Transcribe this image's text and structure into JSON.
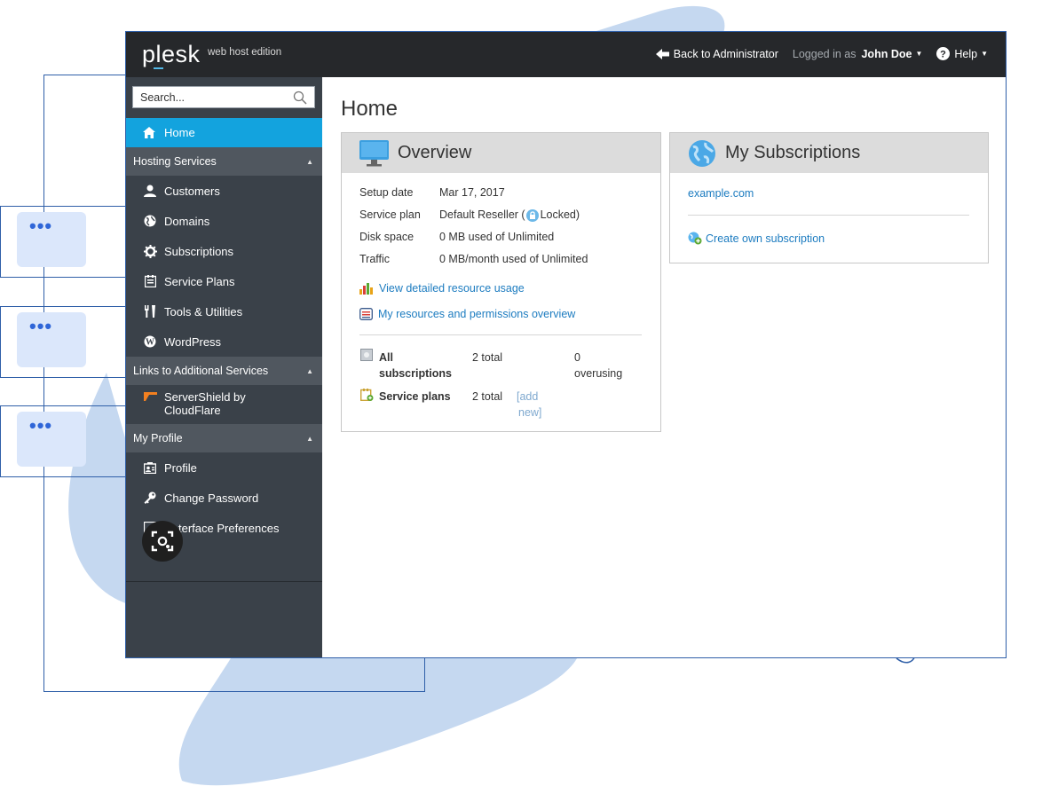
{
  "app": {
    "logo": "plesk",
    "edition": "web host edition"
  },
  "topbar": {
    "back_label": "Back to Administrator",
    "logged_in_prefix": "Logged in as",
    "user_name": "John Doe",
    "help_label": "Help"
  },
  "search": {
    "placeholder": "Search..."
  },
  "sidebar": {
    "home": "Home",
    "hosting_section": "Hosting Services",
    "hosting_items": [
      {
        "label": "Customers",
        "icon": "user-icon"
      },
      {
        "label": "Domains",
        "icon": "globe-icon"
      },
      {
        "label": "Subscriptions",
        "icon": "gear-icon"
      },
      {
        "label": "Service Plans",
        "icon": "plans-icon"
      },
      {
        "label": "Tools & Utilities",
        "icon": "tools-icon"
      },
      {
        "label": "WordPress",
        "icon": "wordpress-icon"
      }
    ],
    "links_section": "Links to Additional Services",
    "links_items": [
      {
        "label_line1": "ServerShield by",
        "label_line2": "CloudFlare",
        "icon": "cloudflare-icon"
      }
    ],
    "profile_section": "My Profile",
    "profile_items": [
      {
        "label": "Profile",
        "icon": "profile-card-icon"
      },
      {
        "label": "Change Password",
        "icon": "key-icon"
      },
      {
        "label": "terface Preferences",
        "icon": "preferences-icon"
      }
    ]
  },
  "main": {
    "title": "Home",
    "overview": {
      "heading": "Overview",
      "rows": [
        {
          "key": "Setup date",
          "value": "Mar 17, 2017"
        },
        {
          "key": "Service plan",
          "value": "Default Reseller (",
          "locked": "Locked)"
        },
        {
          "key": "Disk space",
          "value": "0 MB used of Unlimited"
        },
        {
          "key": "Traffic",
          "value": "0 MB/month used of Unlimited"
        }
      ],
      "link_usage": "View detailed resource usage",
      "link_permissions": "My resources and permissions overview",
      "stats": {
        "subs_label_1": "All",
        "subs_label_2": "subscriptions",
        "subs_total": "2 total",
        "subs_over_1": "0",
        "subs_over_2": "overusing",
        "plans_label": "Service plans",
        "plans_total": "2 total",
        "plans_add_1": "[add",
        "plans_add_2": "new]"
      }
    },
    "subscriptions": {
      "heading": "My Subscriptions",
      "domain": "example.com",
      "create_link": "Create own subscription"
    }
  },
  "colors": {
    "topbar": "#26282b",
    "sidebar": "#3a4149",
    "sidebar_section": "#50575f",
    "active": "#13a3de",
    "link": "#1d7cc0",
    "backdrop_brush": "#c5d8f0",
    "frame_outline": "#2f5fa8"
  }
}
